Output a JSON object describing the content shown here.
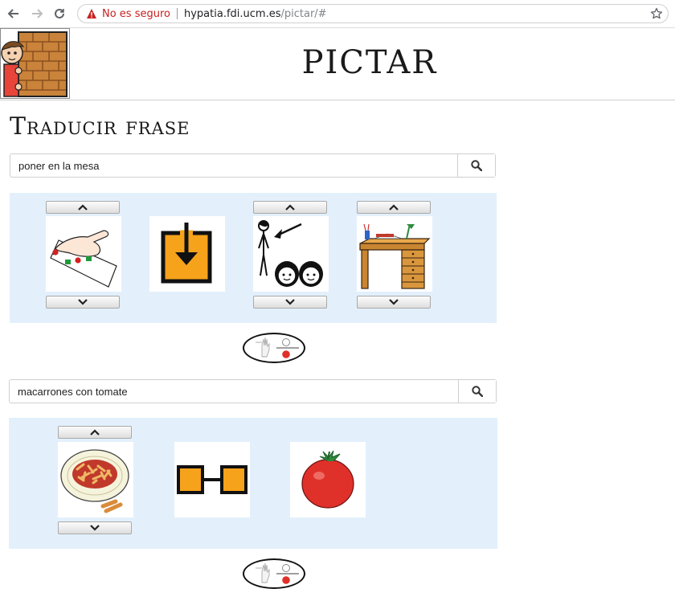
{
  "browser": {
    "security_label": "No es seguro",
    "url_host": "hypatia.fdi.ucm.es",
    "url_path": "/pictar/#",
    "warning_color": "#c5221f"
  },
  "site": {
    "title": "PICTAR",
    "section_title": "Traducir frase"
  },
  "blocks": [
    {
      "query": "poner en la mesa",
      "pictograms": [
        {
          "concept": "poner",
          "has_arrows": true
        },
        {
          "concept": "en",
          "has_arrows": false
        },
        {
          "concept": "la",
          "has_arrows": true
        },
        {
          "concept": "mesa",
          "has_arrows": true
        }
      ]
    },
    {
      "query": "macarrones con tomate",
      "pictograms": [
        {
          "concept": "macarrones",
          "has_arrows": true
        },
        {
          "concept": "con",
          "has_arrows": false
        },
        {
          "concept": "tomate",
          "has_arrows": false
        }
      ]
    }
  ],
  "colors": {
    "panel_bg": "#e3f0fc",
    "pictogram_orange": "#f7a21b",
    "tomato_red": "#e0302a"
  },
  "icons": [
    "back-arrow-icon",
    "forward-arrow-icon",
    "reload-icon",
    "warning-icon",
    "star-icon",
    "search-icon",
    "chevron-up-icon",
    "chevron-down-icon",
    "sign-language-toggle-icon"
  ]
}
